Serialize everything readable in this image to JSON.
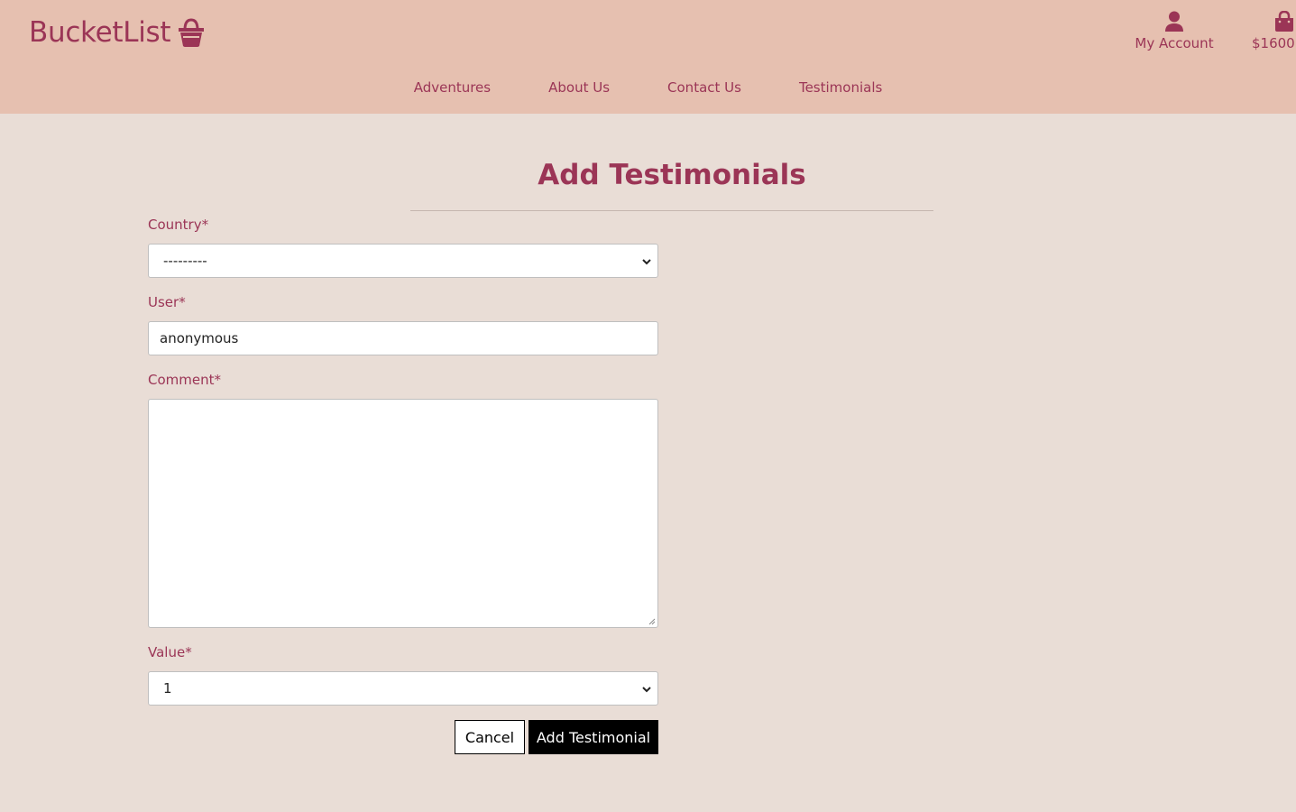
{
  "header": {
    "logo_text": "BucketList",
    "logo_icon": "basket-icon",
    "account": {
      "label": "My Account",
      "icon": "user-icon"
    },
    "bag": {
      "label": "$1600",
      "icon": "shopping-bag-icon"
    },
    "nav": [
      {
        "label": "Adventures"
      },
      {
        "label": "About Us"
      },
      {
        "label": "Contact Us"
      },
      {
        "label": "Testimonials"
      }
    ]
  },
  "form": {
    "title": "Add Testimonials",
    "country": {
      "label": "Country*",
      "value": "---------"
    },
    "user": {
      "label": "User*",
      "value": "anonymous"
    },
    "comment": {
      "label": "Comment*",
      "value": ""
    },
    "rating": {
      "label": "Value*",
      "value": "1"
    },
    "cancel_label": "Cancel",
    "submit_label": "Add Testimonial"
  },
  "colors": {
    "header_bg": "#e6c0b0",
    "page_bg": "#e9ddd6",
    "brand": "#9b3556"
  }
}
